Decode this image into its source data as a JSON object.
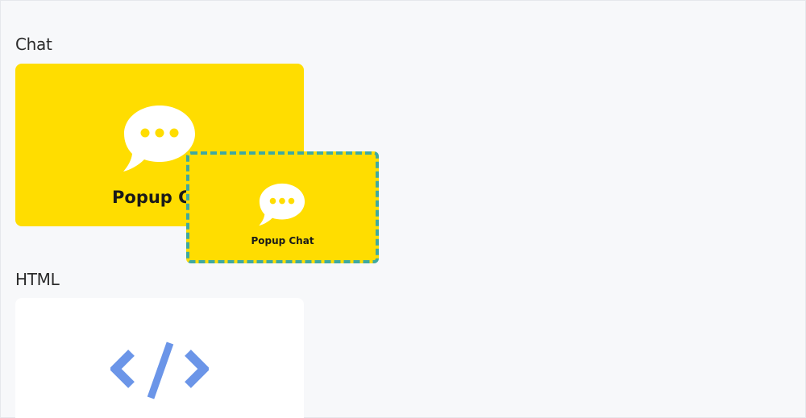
{
  "sections": {
    "chat": {
      "label": "Chat",
      "card": {
        "title": "Popup Chat",
        "icon": "chat-bubble-icon"
      }
    },
    "html": {
      "label": "HTML",
      "card": {
        "icon": "code-brackets-icon"
      }
    }
  },
  "drag_preview": {
    "title": "Popup Chat",
    "icon": "chat-bubble-icon"
  },
  "colors": {
    "background": "#f7f8fa",
    "card_yellow": "#ffdd00",
    "drag_border": "#3fa9a0",
    "code_icon": "#6b95e8",
    "text": "#1a1a1a"
  }
}
